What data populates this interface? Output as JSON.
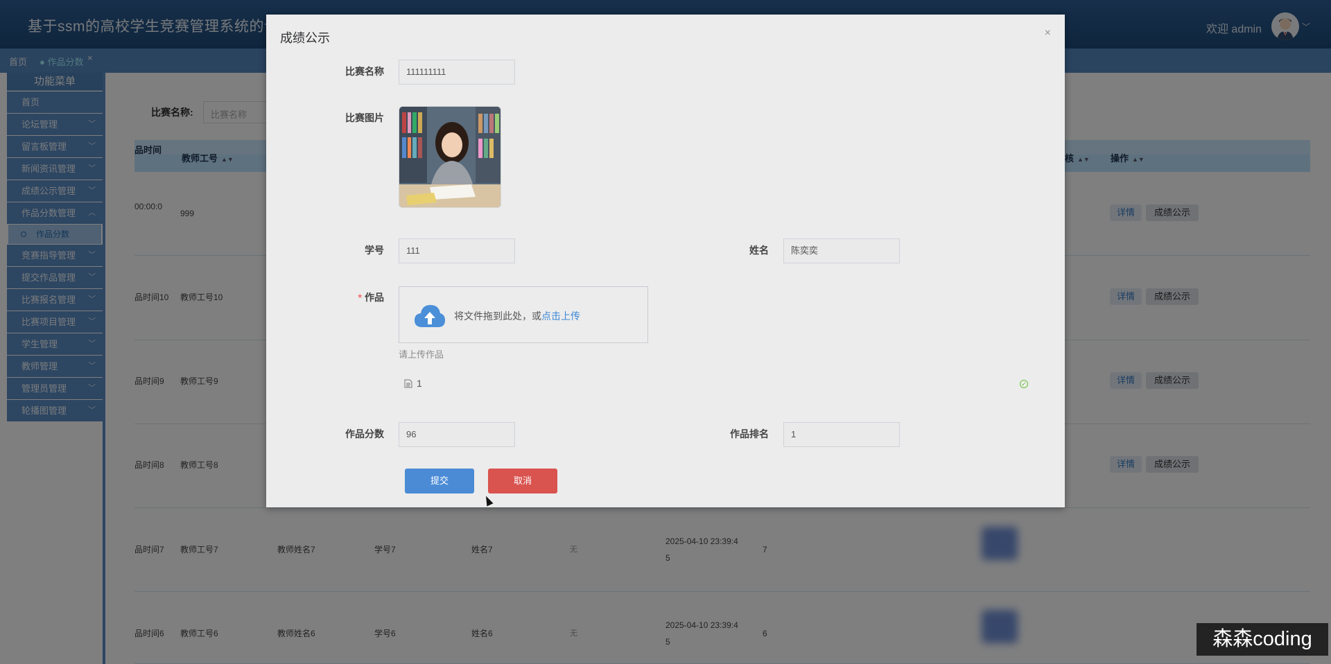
{
  "app": {
    "title": "基于ssm的高校学生竞赛管理系统的设",
    "welcome": "欢迎 admin"
  },
  "tabs": [
    {
      "label": "首页"
    },
    {
      "label": "● 作品分数"
    }
  ],
  "tab_close": "×",
  "sidebar": {
    "title": "功能菜单",
    "items": [
      {
        "label": "首页",
        "arrow": ""
      },
      {
        "label": "论坛管理",
        "arrow": "﹀"
      },
      {
        "label": "留言板管理",
        "arrow": "﹀"
      },
      {
        "label": "新闻资讯管理",
        "arrow": "﹀"
      },
      {
        "label": "成绩公示管理",
        "arrow": "﹀"
      },
      {
        "label": "作品分数管理",
        "arrow": "︿"
      },
      {
        "label": "竞赛指导管理",
        "arrow": "﹀"
      },
      {
        "label": "提交作品管理",
        "arrow": "﹀"
      },
      {
        "label": "比赛报名管理",
        "arrow": "﹀"
      },
      {
        "label": "比赛项目管理",
        "arrow": "﹀"
      },
      {
        "label": "学生管理",
        "arrow": "﹀"
      },
      {
        "label": "教师管理",
        "arrow": "﹀"
      },
      {
        "label": "管理员管理",
        "arrow": "﹀"
      },
      {
        "label": "轮播图管理",
        "arrow": "﹀"
      }
    ],
    "sub_item": "作品分数"
  },
  "search": {
    "label": "比赛名称:",
    "placeholder": "比赛名称"
  },
  "table": {
    "headers": {
      "time": "品时间",
      "teacher_no": "教师工号",
      "audit": "核",
      "actions": "操作"
    },
    "rows": [
      {
        "time": "00:00:0",
        "teacher_no": "999",
        "teacher_name": "",
        "student_no": "",
        "student_name": "",
        "status": "",
        "created": "",
        "rank": ""
      },
      {
        "time": "品时间10",
        "teacher_no": "教师工号10",
        "teacher_name": "",
        "student_no": "",
        "student_name": "",
        "status": "",
        "created": "",
        "rank": ""
      },
      {
        "time": "品时间9",
        "teacher_no": "教师工号9",
        "teacher_name": "",
        "student_no": "",
        "student_name": "",
        "status": "",
        "created": "",
        "rank": ""
      },
      {
        "time": "品时间8",
        "teacher_no": "教师工号8",
        "teacher_name": "",
        "student_no": "",
        "student_name": "",
        "status": "",
        "created": "",
        "rank": ""
      },
      {
        "time": "品时间7",
        "teacher_no": "教师工号7",
        "teacher_name": "教师姓名7",
        "student_no": "学号7",
        "student_name": "姓名7",
        "status": "无",
        "created": "2025-04-10 23:39:45",
        "rank": "7"
      },
      {
        "time": "品时间6",
        "teacher_no": "教师工号6",
        "teacher_name": "教师姓名6",
        "student_no": "学号6",
        "student_name": "姓名6",
        "status": "无",
        "created": "2025-04-10 23:39:45",
        "rank": "6"
      }
    ],
    "detail_label": "详情",
    "score_label": "成绩公示"
  },
  "dialog": {
    "title": "成绩公示",
    "close": "×",
    "fields": {
      "competition_name": {
        "label": "比赛名称",
        "value": "111111111"
      },
      "competition_image": {
        "label": "比赛图片"
      },
      "student_no": {
        "label": "学号",
        "value": "111"
      },
      "student_name": {
        "label": "姓名",
        "value": "陈奕奕"
      },
      "work": {
        "label": "作品",
        "required_mark": "*"
      },
      "score": {
        "label": "作品分数",
        "value": "96"
      },
      "rank": {
        "label": "作品排名",
        "value": "1"
      }
    },
    "upload": {
      "text": "将文件拖到此处，或",
      "link": "点击上传",
      "tip": "请上传作品",
      "file_name": "1",
      "file_icon": "document-icon"
    },
    "submit_label": "提交",
    "cancel_label": "取消"
  },
  "watermark": "森森coding",
  "colors": {
    "primary": "#4b8bd6",
    "danger": "#d9534f",
    "header": "#2e5f95",
    "menu": "#5a8cc4"
  }
}
